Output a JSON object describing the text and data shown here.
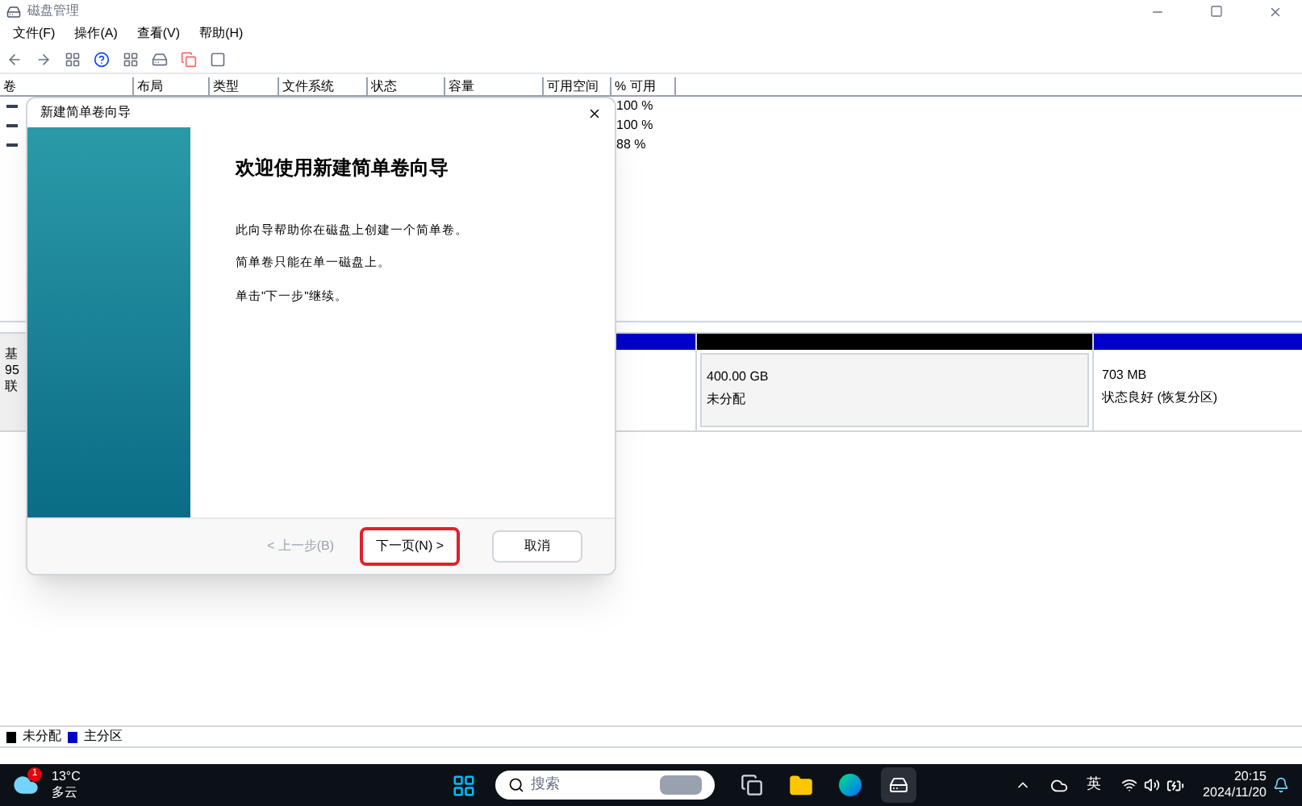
{
  "window": {
    "title": "磁盘管理"
  },
  "menu": [
    "文件(F)",
    "操作(A)",
    "查看(V)",
    "帮助(H)"
  ],
  "table": {
    "columns": [
      "卷",
      "布局",
      "类型",
      "文件系统",
      "状态",
      "容量",
      "可用空间",
      "% 可用"
    ],
    "rows": [
      {
        "percent_free": "100 %"
      },
      {
        "percent_free": "100 %"
      },
      {
        "percent_free": "88 %"
      }
    ]
  },
  "disk": {
    "label_lines": [
      "基",
      "95",
      "联"
    ],
    "partitions": [
      {
        "kind": "primary"
      },
      {
        "kind": "unallocated",
        "size": "400.00 GB",
        "status": "未分配"
      },
      {
        "kind": "primary",
        "size": "703 MB",
        "status": "状态良好 (恢复分区)"
      }
    ]
  },
  "legend": [
    {
      "label": "未分配",
      "color": "#000000"
    },
    {
      "label": "主分区",
      "color": "#0000c8"
    }
  ],
  "dialog": {
    "title": "新建简单卷向导",
    "heading": "欢迎使用新建简单卷向导",
    "paragraphs": [
      "此向导帮助你在磁盘上创建一个简单卷。",
      "简单卷只能在单一磁盘上。",
      "单击\"下一步\"继续。"
    ],
    "buttons": [
      {
        "label": "< 上一步(B)",
        "disabled": true,
        "focused": false
      },
      {
        "label": "下一页(N) >",
        "disabled": false,
        "focused": true
      },
      {
        "label": "取消",
        "disabled": false,
        "focused": false
      }
    ]
  },
  "taskbar": {
    "weather": {
      "badge": "1",
      "temperature": "13°C",
      "condition": "多云"
    },
    "search": {
      "placeholder": "搜索"
    },
    "ime": "英",
    "time": "20:15",
    "date": "2024/11/20"
  }
}
